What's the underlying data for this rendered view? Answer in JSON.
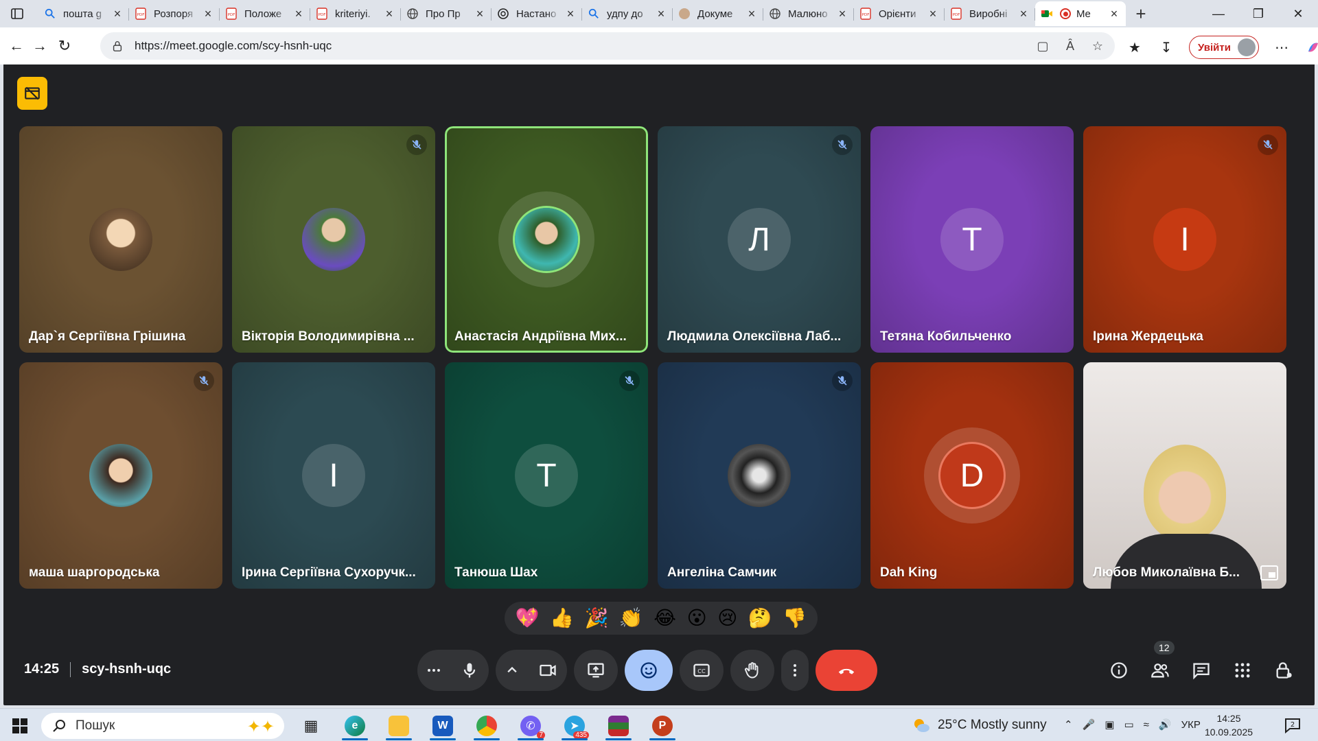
{
  "browser": {
    "tabs": [
      {
        "label": "пошта g",
        "icon": "search-icon"
      },
      {
        "label": "Розпоря",
        "icon": "pdf-icon"
      },
      {
        "label": "Положе",
        "icon": "pdf-icon"
      },
      {
        "label": "kriteriyi.",
        "icon": "pdf-icon"
      },
      {
        "label": "Про Пр",
        "icon": "globe-icon"
      },
      {
        "label": "Настано",
        "icon": "chatgpt-icon"
      },
      {
        "label": "удпу до",
        "icon": "search-icon"
      },
      {
        "label": "Докуме",
        "icon": "doc-icon"
      },
      {
        "label": "Малюно",
        "icon": "globe-icon"
      },
      {
        "label": "Орієнти",
        "icon": "pdf-icon"
      },
      {
        "label": "Виробні",
        "icon": "pdf-icon"
      },
      {
        "label": "Me",
        "icon": "meet-icon",
        "active": true
      }
    ],
    "url": "https://meet.google.com/scy-hsnh-uqc",
    "signin_label": "Увійти"
  },
  "meet": {
    "time": "14:25",
    "meeting_code": "scy-hsnh-uqc",
    "participants_count": "12",
    "participants": [
      {
        "name": "Дар`я Сергіївна Грішина",
        "initial": "",
        "bg": "#6b5232",
        "muted": false
      },
      {
        "name": "Вікторія Володимирівна ...",
        "initial": "",
        "bg": "#4d5e2e",
        "muted": true
      },
      {
        "name": "Анастасія Андріївна Мих...",
        "initial": "",
        "bg": "#3e5a22",
        "muted": false,
        "speaking": true
      },
      {
        "name": "Людмила Олексіївна Лаб...",
        "initial": "Л",
        "bg": "#2f4a52",
        "muted": true
      },
      {
        "name": "Тетяна Кобильченко",
        "initial": "T",
        "bg": "#7b3fb6",
        "muted": false
      },
      {
        "name": "Ірина Жердецька",
        "initial": "I",
        "bg": "#a8350f",
        "muted": true
      },
      {
        "name": "маша шаргородська",
        "initial": "",
        "bg": "#6e4e30",
        "muted": true
      },
      {
        "name": "Ірина Сергіївна Сухоручк...",
        "initial": "I",
        "bg": "#2c4a52",
        "muted": false
      },
      {
        "name": "Танюша Шах",
        "initial": "T",
        "bg": "#0e4e3e",
        "muted": true
      },
      {
        "name": "Ангеліна Самчик",
        "initial": "",
        "bg": "#213a56",
        "muted": true
      },
      {
        "name": "Dah King",
        "initial": "D",
        "bg": "#a3310f",
        "muted": false
      },
      {
        "name": "Любов Миколаївна Б...",
        "initial": "",
        "bg": "#d8d4d2",
        "muted": false
      }
    ],
    "reactions": [
      "💖",
      "👍",
      "🎉",
      "👏",
      "😂",
      "😮",
      "😢",
      "🤔",
      "👎"
    ]
  },
  "taskbar": {
    "search_label": "Пошук",
    "weather": "25°C  Mostly sunny",
    "lang": "УКР",
    "time": "14:25",
    "date": "10.09.2025",
    "viber_count": "7",
    "telegram_count": "435"
  }
}
